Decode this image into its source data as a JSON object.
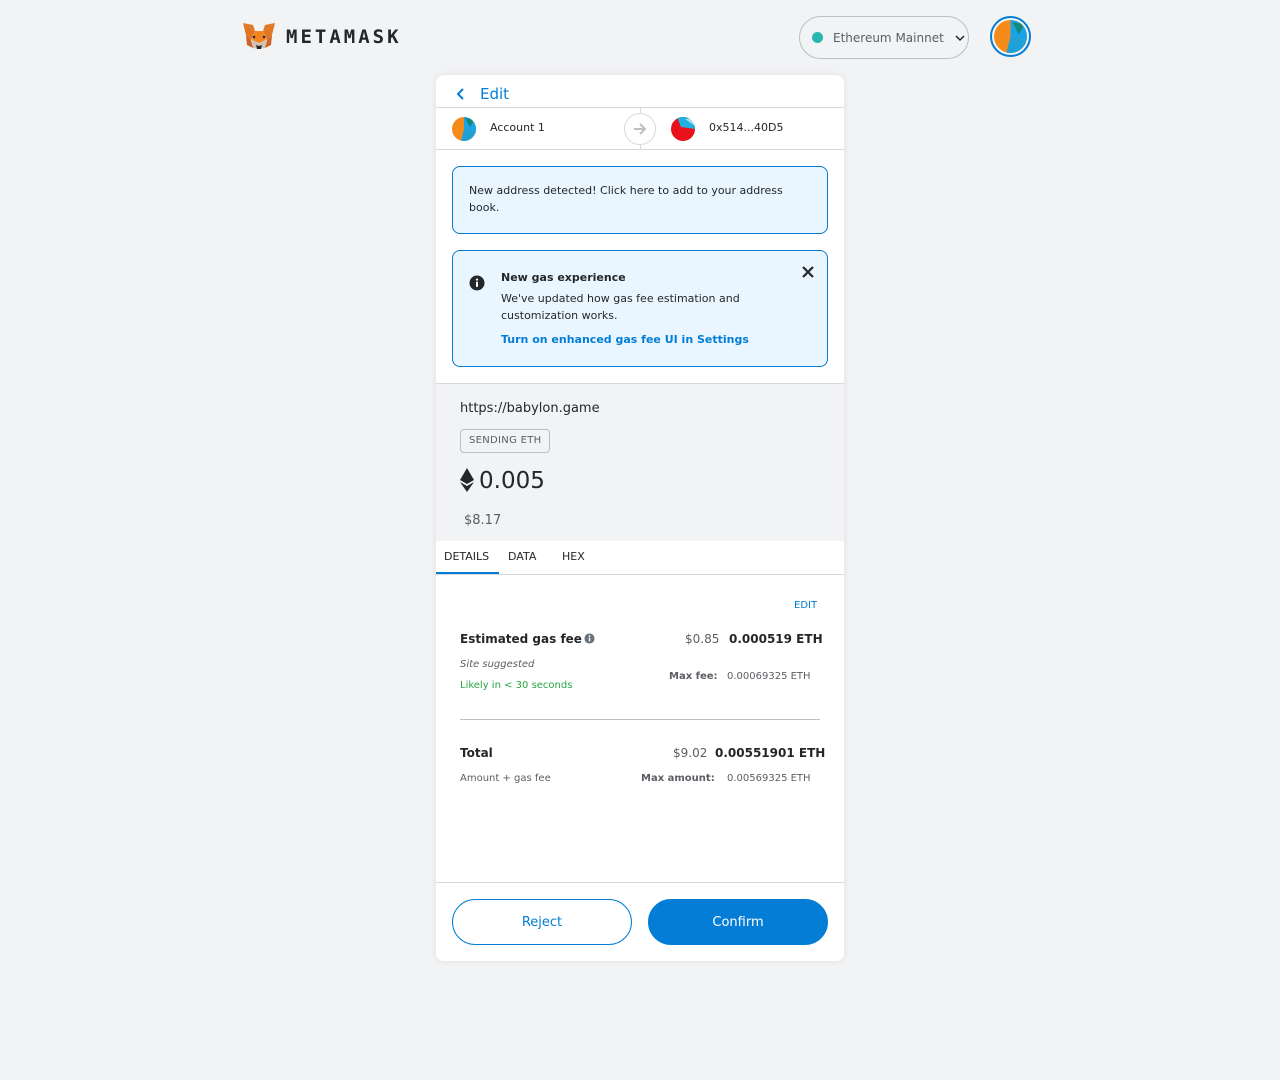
{
  "header": {
    "brand": "METAMASK",
    "network": "Ethereum Mainnet",
    "network_color": "#29b6af"
  },
  "nav": {
    "back_label": "Edit"
  },
  "transfer": {
    "from_name": "Account 1",
    "to_address": "0x514...40D5"
  },
  "notices": {
    "address": "New address detected! Click here to add to your address book.",
    "gas_title": "New gas experience",
    "gas_body": "We've updated how gas fee estimation and customization works.",
    "gas_link": "Turn on enhanced gas fee UI in Settings"
  },
  "summary": {
    "origin": "https://babylon.game",
    "action": "SENDING ETH",
    "amount": "0.005",
    "amount_fiat": "$8.17"
  },
  "tabs": [
    "DETAILS",
    "DATA",
    "HEX"
  ],
  "details": {
    "edit_label": "EDIT",
    "gas_label": "Estimated gas fee",
    "gas_fiat": "$0.85",
    "gas_eth": "0.000519 ETH",
    "site_suggested": "Site suggested",
    "likely": "Likely in < 30 seconds",
    "max_fee_label": "Max fee:",
    "max_fee_value": "0.00069325 ETH",
    "total_label": "Total",
    "total_fiat": "$9.02",
    "total_eth": "0.00551901 ETH",
    "amount_gas_label": "Amount + gas fee",
    "max_amount_label": "Max amount:",
    "max_amount_value": "0.00569325 ETH"
  },
  "footer": {
    "reject": "Reject",
    "confirm": "Confirm"
  },
  "colors": {
    "primary": "#037dd6",
    "success": "#28a745",
    "background": "#f2f3f4"
  }
}
